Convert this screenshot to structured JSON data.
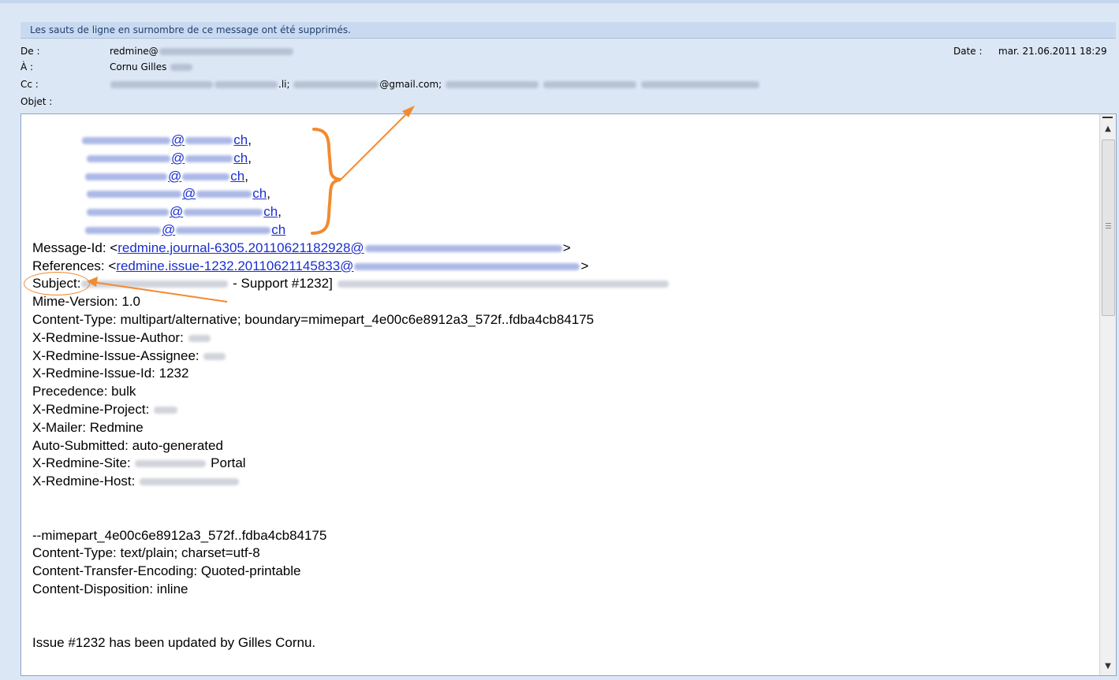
{
  "info_bar": "Les sauts de ligne en surnombre de ce message ont été supprimés.",
  "header": {
    "from_label": "De :",
    "from_value": "redmine@",
    "to_label": "À :",
    "to_value": "Cornu Gilles",
    "cc_label": "Cc :",
    "cc_fragment_1": ".li;",
    "cc_fragment_2": "@gmail.com;",
    "subject_label": "Objet :",
    "date_label": "Date :",
    "date_value": "mar. 21.06.2011 18:29"
  },
  "body": {
    "recipients": [
      {
        "suffix_at": "@",
        "suffix_domain": "ch",
        "trail": ","
      },
      {
        "suffix_at": "@",
        "suffix_domain": "ch",
        "trail": ","
      },
      {
        "suffix_at": "@",
        "suffix_domain": "ch",
        "trail": ","
      },
      {
        "suffix_at": "@",
        "suffix_domain": "ch",
        "trail": ","
      },
      {
        "suffix_at": "@",
        "suffix_domain": "ch",
        "trail": ","
      },
      {
        "suffix_at": "@",
        "suffix_domain": "ch",
        "trail": ""
      }
    ],
    "message_id_label": "Message-Id: <",
    "message_id_link": "redmine.journal-6305.20110621182928@",
    "message_id_end": ">",
    "references_label": "References: <",
    "references_link": "redmine.issue-1232.20110621145833@",
    "references_end": ">",
    "subject_label": "Subject:",
    "subject_text": " - Support #1232]",
    "headers": [
      "Mime-Version: 1.0",
      "Content-Type: multipart/alternative; boundary=mimepart_4e00c6e8912a3_572f..fdba4cb84175",
      "X-Redmine-Issue-Author:",
      "X-Redmine-Issue-Assignee:",
      "X-Redmine-Issue-Id: 1232",
      "Precedence: bulk",
      "X-Redmine-Project:",
      "X-Mailer: Redmine",
      "Auto-Submitted: auto-generated",
      "X-Redmine-Site:",
      "X-Redmine-Host:"
    ],
    "site_suffix": " Portal",
    "mime_lines": [
      "--mimepart_4e00c6e8912a3_572f..fdba4cb84175",
      "Content-Type: text/plain; charset=utf-8",
      "Content-Transfer-Encoding: Quoted-printable",
      "Content-Disposition: inline"
    ],
    "issue_line": "Issue #1232 has been updated by Gilles Cornu."
  },
  "colors": {
    "annotation": "#f28a2e",
    "link": "#1a2fd0",
    "info_bar_bg": "#c9daf0"
  }
}
